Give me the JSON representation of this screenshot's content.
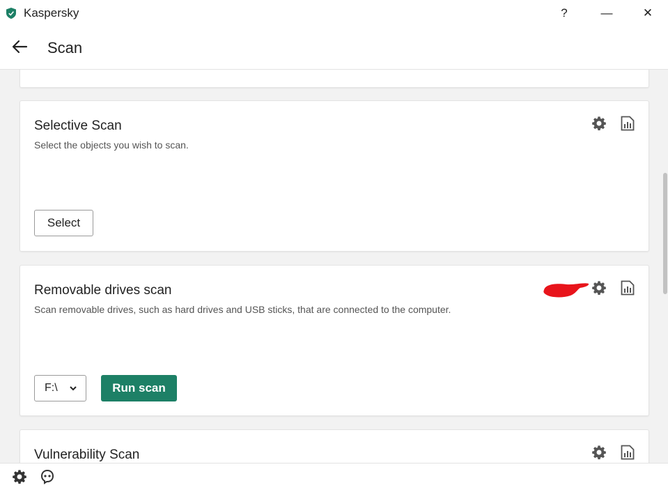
{
  "window": {
    "title": "Kaspersky",
    "help_label": "?",
    "minimize_label": "—",
    "close_label": "✕"
  },
  "header": {
    "title": "Scan"
  },
  "cards": {
    "selective": {
      "title": "Selective Scan",
      "description": "Select the objects you wish to scan.",
      "select_label": "Select"
    },
    "removable": {
      "title": "Removable drives scan",
      "description": "Scan removable drives, such as hard drives and USB sticks, that are connected to the computer.",
      "drive_value": "F:\\",
      "run_label": "Run scan"
    },
    "vulnerability": {
      "title": "Vulnerability Scan"
    }
  },
  "icons": {
    "settings": "gear-icon",
    "report": "report-icon",
    "back": "back-arrow-icon",
    "support": "support-icon"
  },
  "colors": {
    "accent": "#1d8066",
    "annotation": "#e8141b"
  }
}
